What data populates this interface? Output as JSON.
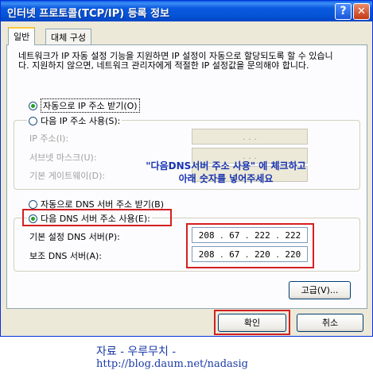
{
  "window": {
    "title": "인터넷 프로토콜(TCP/IP) 등록 정보",
    "help_btn": "?",
    "close_btn": "✕"
  },
  "tabs": [
    "일반",
    "대체 구성"
  ],
  "description": "네트워크가 IP 자동 설정 기능을 지원하면 IP 설정이 자동으로 할당되도록 할 수 있습니다. 지원하지 않으면, 네트워크 관리자에게 적절한 IP 설정값을 문의해야 합니다.",
  "ip_section": {
    "auto_radio": "자동으로 IP 주소 받기(O)",
    "manual_radio": "다음 IP 주소 사용(S):",
    "fields": [
      {
        "label": "IP 주소(I):",
        "value": ".   .   ."
      },
      {
        "label": "서브넷 마스크(U):",
        "value": ".   .   ."
      },
      {
        "label": "기본 게이트웨이(D):",
        "value": ".   .   ."
      }
    ]
  },
  "dns_section": {
    "auto_radio": "자동으로 DNS 서버 주소 받기(B)",
    "manual_radio": "다음 DNS 서버 주소 사용(E):",
    "preferred": {
      "label": "기본 설정 DNS 서버(P):",
      "octets": [
        "208",
        "67",
        "222",
        "222"
      ]
    },
    "alternate": {
      "label": "보조 DNS 서버(A):",
      "octets": [
        "208",
        "67",
        "220",
        "220"
      ]
    }
  },
  "annotation": {
    "line1": "\"다음DNS서버 주소 사용\" 에 체크하고",
    "line2": "아래 숫자를 넣어주세요"
  },
  "buttons": {
    "advanced": "고급(V)...",
    "ok": "확인",
    "cancel": "취소"
  },
  "caption": {
    "line1": "자료 - 우루무치 -",
    "line2": "http://blog.daum.net/nadasig"
  },
  "colors": {
    "annotation": "#1833b0",
    "highlight_box": "#d42020",
    "caption": "#1a3aa6"
  }
}
